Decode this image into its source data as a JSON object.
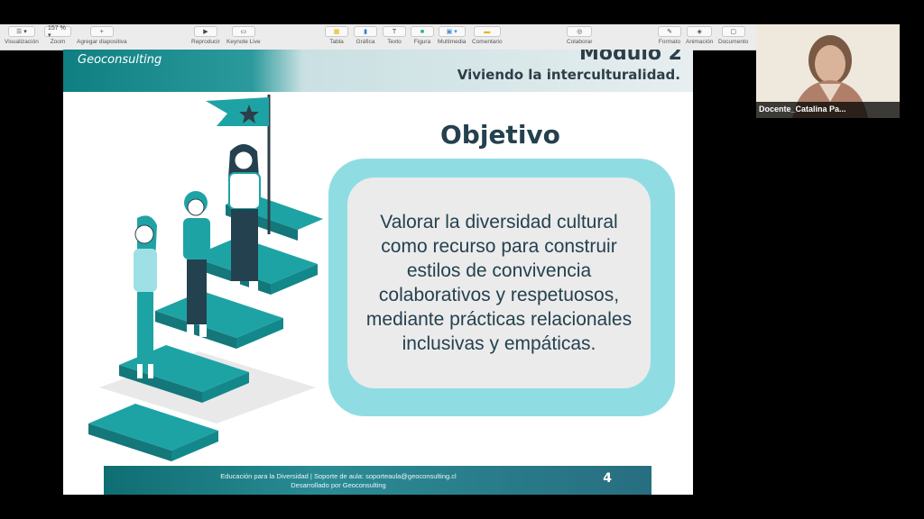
{
  "toolbar": {
    "items": [
      {
        "label": "Visualización",
        "btn": "☰ ▾",
        "icon": "sidebar-icon"
      },
      {
        "label": "Zoom",
        "btn": "157 % ▾",
        "icon": "zoom-icon"
      },
      {
        "label": "Agregar diapositiva",
        "btn": "+",
        "icon": "plus-icon"
      },
      {
        "label": "Reproducir",
        "btn": "▶",
        "icon": "play-icon"
      },
      {
        "label": "Keynote Live",
        "btn": "▭",
        "icon": "keynote-live-icon"
      },
      {
        "label": "Tabla",
        "btn": "▦",
        "icon": "table-icon"
      },
      {
        "label": "Gráfica",
        "btn": "▮",
        "icon": "chart-icon"
      },
      {
        "label": "Texto",
        "btn": "T",
        "icon": "text-icon"
      },
      {
        "label": "Figura",
        "btn": "■",
        "icon": "shape-icon"
      },
      {
        "label": "Multimedia",
        "btn": "▣ ▾",
        "icon": "media-icon"
      },
      {
        "label": "Comentario",
        "btn": "▬",
        "icon": "comment-icon"
      },
      {
        "label": "Colaborar",
        "btn": "◎",
        "icon": "collaborate-icon"
      },
      {
        "label": "Formato",
        "btn": "✎",
        "icon": "format-icon"
      },
      {
        "label": "Animación",
        "btn": "◈",
        "icon": "animation-icon"
      },
      {
        "label": "Documento",
        "btn": "▢",
        "icon": "document-icon"
      }
    ]
  },
  "slide": {
    "logo": "Geoconsulting",
    "module_title": "Modulo 2",
    "subtitle": "Viviendo la interculturalidad.",
    "heading": "Objetivo",
    "objective": "Valorar la diversidad cultural como recurso para construir estilos de convivencia colaborativos y respetuosos, mediante prácticas relacionales inclusivas y empáticas.",
    "footer_line1": "Educación para la Diversidad | Soporte de aula: soporteaula@geoconsulting.cl",
    "footer_line2": "Desarrollado por Geoconsulting",
    "page_number": "4"
  },
  "video": {
    "participant_name": "Docente_Catalina Pa..."
  },
  "colors": {
    "teal": "#1ea3a5",
    "light_teal": "#8fdde3",
    "dark_text": "#24414f",
    "toolbar_bg": "#ececec"
  }
}
